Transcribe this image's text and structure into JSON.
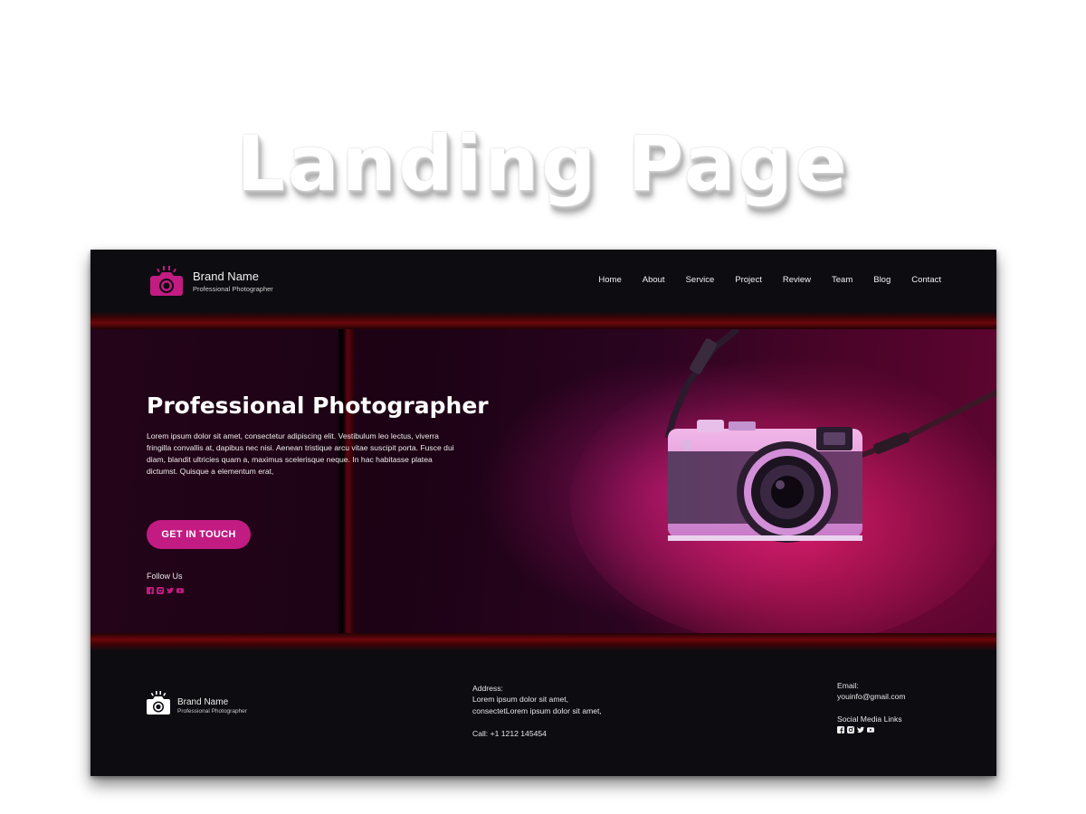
{
  "heading": "Landing Page",
  "header": {
    "brand_name": "Brand Name",
    "brand_subtitle": "Professional Photographer",
    "nav": [
      "Home",
      "About",
      "Service",
      "Project",
      "Review",
      "Team",
      "Blog",
      "Contact"
    ]
  },
  "hero": {
    "title": "Professional Photographer",
    "description": "Lorem ipsum dolor sit amet, consectetur adipiscing elit. Vestibulum leo lectus, viverra fringilla convallis at, dapibus nec nisi. Aenean tristique arcu vitae suscipit porta. Fusce dui diam, blandit ultricies quam a, maximus scelerisque neque. In hac habitasse platea dictumst. Quisque a elementum erat,",
    "cta_label": "GET IN TOUCH",
    "follow_label": "Follow Us",
    "social_icons": [
      "facebook-icon",
      "instagram-icon",
      "twitter-icon",
      "youtube-icon"
    ]
  },
  "footer": {
    "brand_name": "Brand Name",
    "brand_subtitle": "Professional Photographer",
    "address_label": "Address:",
    "address_line1": "Lorem ipsum dolor sit amet,",
    "address_line2": "consectetLorem ipsum dolor sit amet,",
    "phone": "Call: +1 1212 145454",
    "email_label": "Email:",
    "email": "youinfo@gmail.com",
    "social_label": "Social Media Links",
    "social_icons": [
      "facebook-icon",
      "instagram-icon",
      "twitter-icon",
      "youtube-icon"
    ]
  },
  "colors": {
    "accent": "#c21b82",
    "background": "#0c0c11",
    "band_red": "#6b070c"
  }
}
